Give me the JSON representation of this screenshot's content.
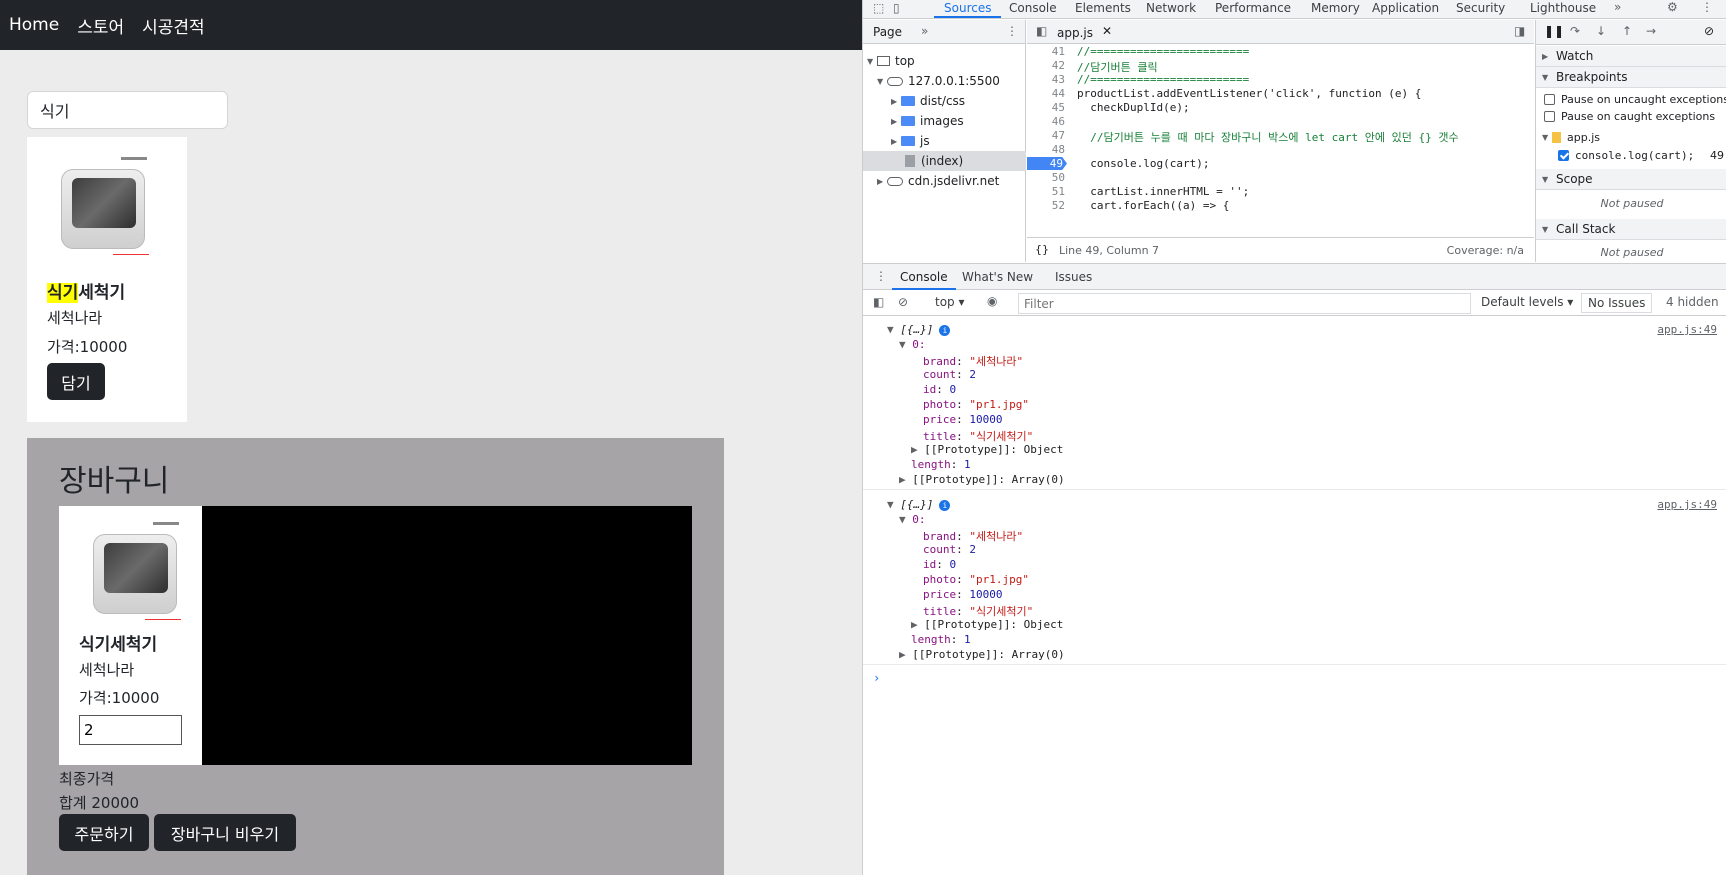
{
  "site": {
    "nav": [
      "Home",
      "스토어",
      "시공견적"
    ],
    "search_value": "식기",
    "product": {
      "title_highlight": "식기",
      "title_rest": "세척기",
      "brand": "세척나라",
      "price": "가격:10000",
      "add_button": "담기"
    },
    "cart": {
      "title": "장바구니",
      "item_title": "식기세척기",
      "item_brand": "세척나라",
      "item_price": "가격:10000",
      "quantity": "2",
      "final_label": "최종가격",
      "total": "합계 20000",
      "order_button": "주문하기",
      "clear_button": "장바구니 비우기"
    }
  },
  "devtools": {
    "tabs": [
      "Sources",
      "Console",
      "Elements",
      "Network",
      "Performance",
      "Memory",
      "Application",
      "Security",
      "Lighthouse"
    ],
    "active_tab": "Sources",
    "navigator": {
      "tab": "Page",
      "tree": [
        {
          "label": "top",
          "kind": "frame"
        },
        {
          "label": "127.0.0.1:5500",
          "kind": "cloud"
        },
        {
          "label": "dist/css",
          "kind": "folder"
        },
        {
          "label": "images",
          "kind": "folder"
        },
        {
          "label": "js",
          "kind": "folder"
        },
        {
          "label": "(index)",
          "kind": "file"
        },
        {
          "label": "cdn.jsdelivr.net",
          "kind": "cloud"
        }
      ]
    },
    "editor": {
      "file_tab": "app.js",
      "lines": [
        {
          "n": "41",
          "code": "//========================",
          "type": "comment"
        },
        {
          "n": "42",
          "code": "//담기버튼 클릭",
          "type": "comment"
        },
        {
          "n": "43",
          "code": "//========================",
          "type": "comment"
        },
        {
          "n": "44",
          "code": "productList.addEventListener('click', function (e) {",
          "type": "code"
        },
        {
          "n": "45",
          "code": "  checkDuplId(e);",
          "type": "code"
        },
        {
          "n": "46",
          "code": "",
          "type": "code"
        },
        {
          "n": "47",
          "code": "  //담기버튼 누를 때 마다 장바구니 박스에 let cart 안에 있던 {} 갯수",
          "type": "comment"
        },
        {
          "n": "48",
          "code": "",
          "type": "code"
        },
        {
          "n": "49",
          "code": "  console.log(cart);",
          "type": "code"
        },
        {
          "n": "50",
          "code": "",
          "type": "code"
        },
        {
          "n": "51",
          "code": "  cartList.innerHTML = '';",
          "type": "code"
        },
        {
          "n": "52",
          "code": "  cart.forEach((a) => {",
          "type": "code"
        }
      ],
      "status": "Line 49, Column 7",
      "coverage": "Coverage: n/a"
    },
    "sidebar": {
      "watch": "Watch",
      "breakpoints": "Breakpoints",
      "pause_uncaught": "Pause on uncaught exceptions",
      "pause_caught": "Pause on caught exceptions",
      "bp_file": "app.js",
      "bp_code": "console.log(cart);",
      "bp_line": "49",
      "scope": "Scope",
      "scope_status": "Not paused",
      "callstack": "Call Stack",
      "callstack_status": "Not paused"
    },
    "drawer_tabs": [
      "Console",
      "What's New",
      "Issues"
    ],
    "console_toolbar": {
      "context": "top",
      "filter_placeholder": "Filter",
      "levels": "Default levels",
      "issues": "No Issues",
      "hidden": "4 hidden"
    },
    "console_logs": [
      {
        "summary": "[{…}]",
        "source": "app.js:49",
        "index": "0:",
        "props": [
          {
            "key": "brand",
            "value": "\"세척나라\"",
            "type": "string"
          },
          {
            "key": "count",
            "value": "2",
            "type": "number"
          },
          {
            "key": "id",
            "value": "0",
            "type": "number"
          },
          {
            "key": "photo",
            "value": "\"pr1.jpg\"",
            "type": "string"
          },
          {
            "key": "price",
            "value": "10000",
            "type": "number"
          },
          {
            "key": "title",
            "value": "\"식기세척기\"",
            "type": "string"
          }
        ],
        "proto_obj": "[[Prototype]]: Object",
        "length": "1",
        "proto_arr": "[[Prototype]]: Array(0)"
      },
      {
        "summary": "[{…}]",
        "source": "app.js:49",
        "index": "0:",
        "props": [
          {
            "key": "brand",
            "value": "\"세척나라\"",
            "type": "string"
          },
          {
            "key": "count",
            "value": "2",
            "type": "number"
          },
          {
            "key": "id",
            "value": "0",
            "type": "number"
          },
          {
            "key": "photo",
            "value": "\"pr1.jpg\"",
            "type": "string"
          },
          {
            "key": "price",
            "value": "10000",
            "type": "number"
          },
          {
            "key": "title",
            "value": "\"식기세척기\"",
            "type": "string"
          }
        ],
        "proto_obj": "[[Prototype]]: Object",
        "length": "1",
        "proto_arr": "[[Prototype]]: Array(0)"
      }
    ],
    "prompt": "›"
  }
}
